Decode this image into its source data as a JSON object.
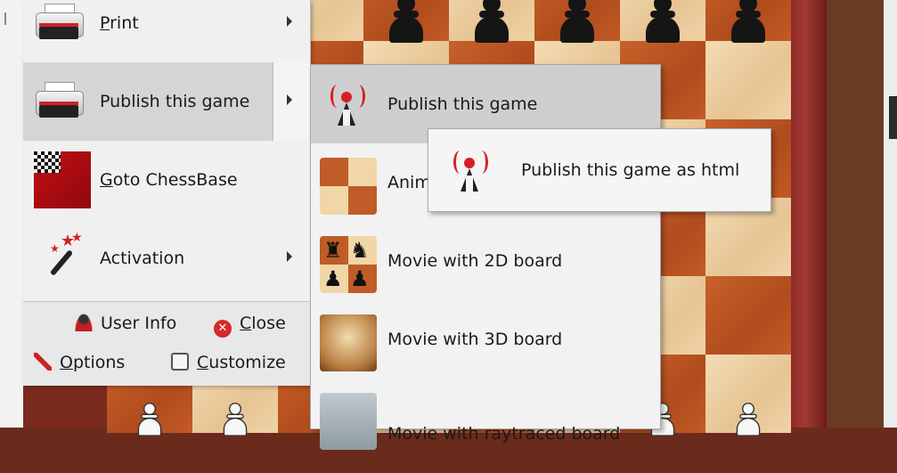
{
  "main_menu": {
    "items": [
      {
        "label_access": "P",
        "label_rest": "rint",
        "icon": "printer-icon",
        "has_submenu": true
      },
      {
        "label": "Publish this game",
        "icon": "printer-icon",
        "has_submenu": true,
        "highlighted": true
      },
      {
        "label_access": "G",
        "label_rest": "oto ChessBase",
        "icon": "chessbase-logo"
      },
      {
        "label": "Activation",
        "icon": "magic-wand-icon",
        "has_submenu": true
      }
    ],
    "footer": {
      "user_info": "User Info",
      "close_access": "C",
      "close_rest": "lose",
      "options_access": "O",
      "options_rest": "ptions",
      "customize_access": "C",
      "customize_rest": "ustomize"
    }
  },
  "submenu": {
    "items": [
      {
        "label": "Publish this game",
        "icon": "radio-tower-icon",
        "highlighted": true
      },
      {
        "label": "Anim",
        "icon": "animation-board-thumbnail"
      },
      {
        "label": "Movie with 2D board",
        "icon": "2d-board-thumbnail"
      },
      {
        "label": "Movie with 3D board",
        "icon": "3d-board-thumbnail"
      },
      {
        "label": "Movie with raytraced board",
        "icon": "raytraced-board-thumbnail"
      }
    ]
  },
  "submenu2": {
    "items": [
      {
        "label": "Publish this game as html",
        "icon": "radio-tower-icon"
      }
    ]
  },
  "colors": {
    "menu_bg": "#f0f0f0",
    "highlight": "#d5d5d5",
    "light_square": "#f1d6a8",
    "dark_square": "#bf5c28",
    "accent_red": "#d61f26"
  }
}
